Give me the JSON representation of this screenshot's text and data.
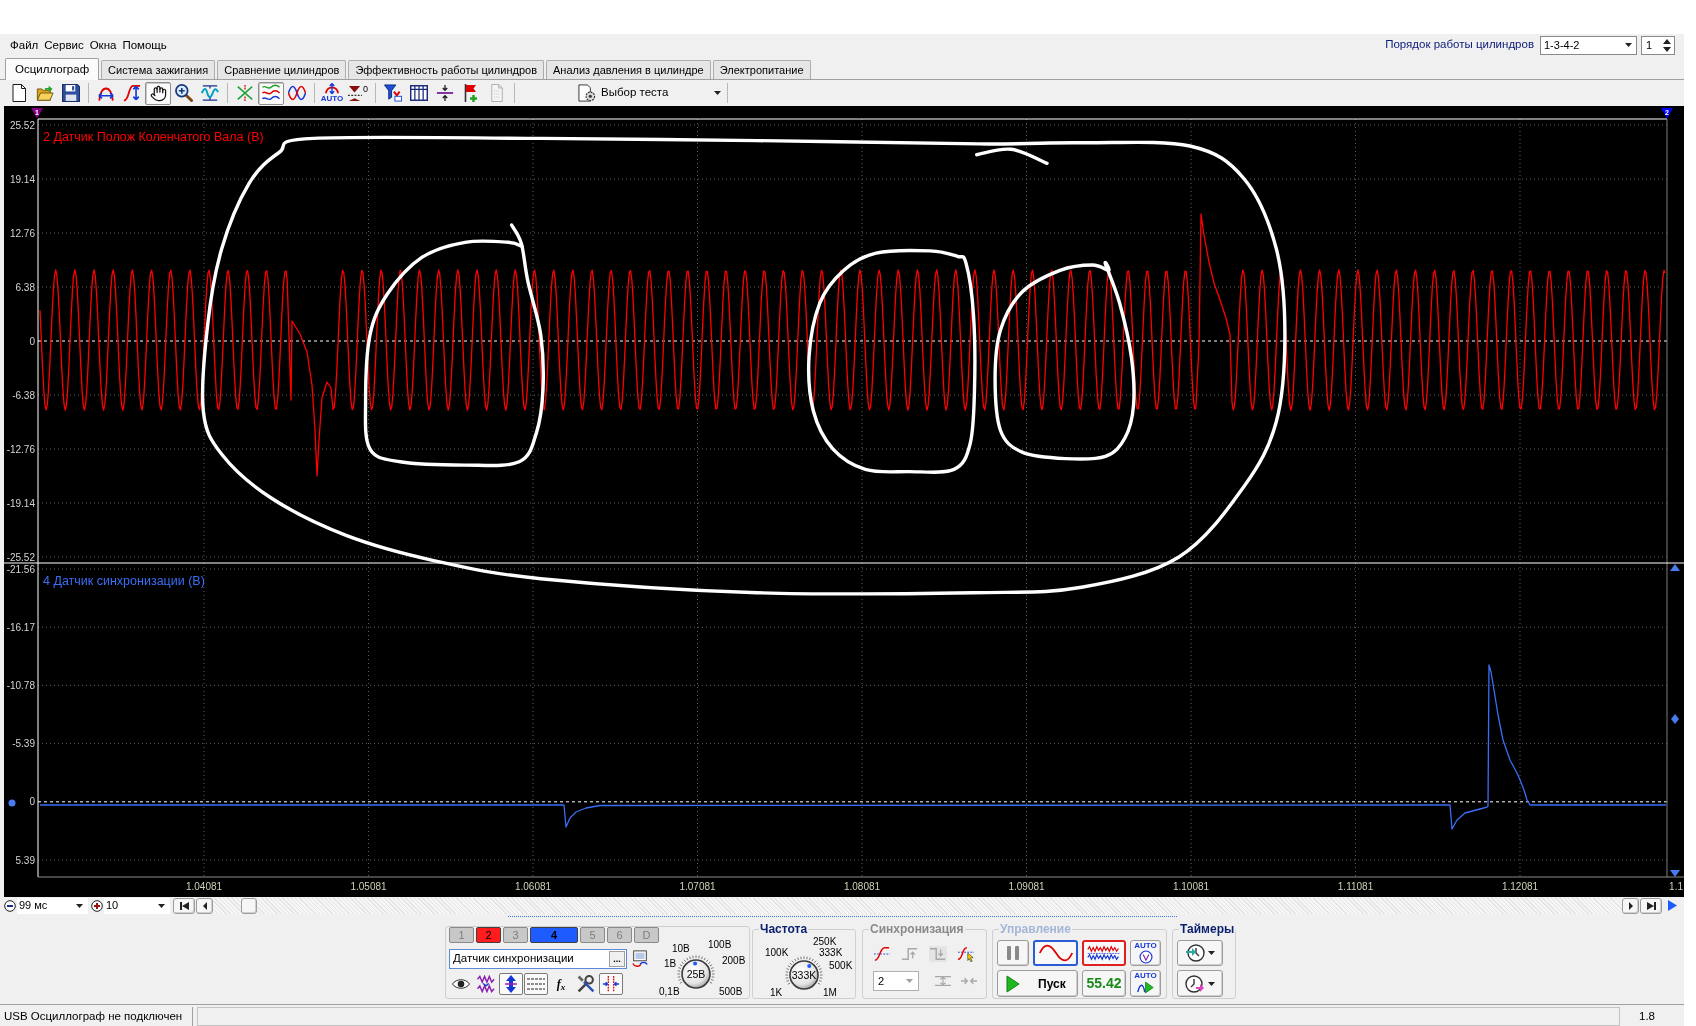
{
  "menu": [
    "Файл",
    "Сервис",
    "Окна",
    "Помощь"
  ],
  "cylinder_order": {
    "label": "Порядок работы цилиндров",
    "value": "1-3-4-2",
    "counter": "1"
  },
  "tabs": [
    {
      "label": "Осциллограф",
      "selected": true
    },
    {
      "label": "Система зажигания",
      "selected": false
    },
    {
      "label": "Сравнение цилиндров",
      "selected": false
    },
    {
      "label": "Эффективность работы цилиндров",
      "selected": false
    },
    {
      "label": "Анализ давления в цилиндре",
      "selected": false
    },
    {
      "label": "Электропитание",
      "selected": false
    }
  ],
  "toolbar": {
    "groups": [
      [
        {
          "kind": "new",
          "pressed": false
        },
        {
          "kind": "open",
          "pressed": false
        },
        {
          "kind": "save",
          "pressed": false
        }
      ],
      [
        {
          "kind": "width",
          "pressed": false
        },
        {
          "kind": "height",
          "pressed": false
        },
        {
          "kind": "hand",
          "pressed": true
        },
        {
          "kind": "zoom",
          "pressed": false
        },
        {
          "kind": "fit",
          "pressed": false
        }
      ],
      [
        {
          "kind": "cross",
          "pressed": false
        },
        {
          "kind": "stack",
          "pressed": true
        },
        {
          "kind": "overlap",
          "pressed": false
        }
      ],
      [
        {
          "kind": "auto",
          "pressed": false,
          "label": "AUTO"
        },
        {
          "kind": "zero",
          "pressed": false,
          "label": "0"
        }
      ],
      [
        {
          "kind": "filter",
          "pressed": false
        },
        {
          "kind": "grid",
          "pressed": false
        },
        {
          "kind": "split",
          "pressed": false
        },
        {
          "kind": "flag",
          "pressed": false
        },
        {
          "kind": "list",
          "pressed": false
        }
      ]
    ],
    "test_select": "Выбор теста"
  },
  "plot": {
    "markers": [
      {
        "label": "1",
        "color": "#800080"
      },
      {
        "label": "2",
        "color": "#0000ff"
      }
    ],
    "channels": [
      {
        "title": "2 Датчик Полож Коленчатого Вала (В)",
        "color": "#ff0000",
        "y_ticks": [
          {
            "label": "25.52",
            "kind": "grid"
          },
          {
            "label": "19.14",
            "kind": "grid"
          },
          {
            "label": "12.76",
            "kind": "grid"
          },
          {
            "label": "6.38",
            "kind": "grid"
          },
          {
            "label": "0",
            "kind": "zero"
          },
          {
            "label": "-6.38",
            "kind": "grid"
          },
          {
            "label": "-12.76",
            "kind": "grid"
          },
          {
            "label": "-19.14",
            "kind": "grid"
          },
          {
            "label": "-25.52",
            "kind": "grid"
          }
        ]
      },
      {
        "title": "4 Датчик синхронизации (В)",
        "color": "#3a6ef5",
        "y_ticks": [
          {
            "label": "-21.56",
            "kind": "grid"
          },
          {
            "label": "-16.17",
            "kind": "grid"
          },
          {
            "label": "-10.78",
            "kind": "grid"
          },
          {
            "label": "-5.39",
            "kind": "grid"
          },
          {
            "label": "0",
            "kind": "zero"
          },
          {
            "label": "5.39",
            "kind": "grid"
          }
        ]
      }
    ],
    "x_labels": [
      "1.04081",
      "1.05081",
      "1.06081",
      "1.07081",
      "1.08081",
      "1.09081",
      "1.10081",
      "1.11081",
      "1.12081",
      "1.1"
    ]
  },
  "time_bar": {
    "time_per_div": "99 мс",
    "zoom": "10"
  },
  "bottom_panel": {
    "channel_buttons": [
      {
        "label": "1",
        "on": false,
        "selected": false,
        "color": "#c8c8c8"
      },
      {
        "label": "2",
        "on": true,
        "selected": false,
        "color": "#ff1c1c"
      },
      {
        "label": "3",
        "on": false,
        "selected": false,
        "color": "#c8c8c8"
      },
      {
        "label": "4",
        "on": true,
        "selected": true,
        "color": "#1f5cff"
      },
      {
        "label": "5",
        "on": false,
        "selected": false,
        "color": "#c8c8c8"
      },
      {
        "label": "6",
        "on": false,
        "selected": false,
        "color": "#c8c8c8"
      },
      {
        "label": "D",
        "on": false,
        "selected": false,
        "color": "#c8c8c8"
      }
    ],
    "channel_name": "Датчик синхронизации",
    "channel_name_button": "...",
    "channel_tools": [
      {
        "kind": "eye",
        "pressed": false
      },
      {
        "kind": "wave",
        "pressed": false
      },
      {
        "kind": "updown",
        "pressed": true
      },
      {
        "kind": "lines",
        "pressed": true
      },
      {
        "kind": "formula",
        "pressed": false,
        "label": "f$_{x}$"
      },
      {
        "kind": "tools",
        "pressed": false
      },
      {
        "kind": "cursor",
        "pressed": true
      }
    ],
    "voltage_dial": {
      "labels": [
        "10В",
        "100В",
        "1В",
        "200В",
        "0,1В",
        "500В"
      ],
      "value": "25В"
    },
    "frequency": {
      "title": "Частота",
      "labels": [
        "250K",
        "100K",
        "333K",
        "500K",
        "1K",
        "1M"
      ],
      "value": "333K"
    },
    "sync": {
      "title": "Синхронизация",
      "disabled": true,
      "channel": "2"
    },
    "control": {
      "title": "Управление",
      "buttons": [
        {
          "kind": "pause"
        },
        {
          "kind": "sine"
        },
        {
          "kind": "noise"
        },
        {
          "kind": "auto-view",
          "label": "AUTO"
        },
        {
          "kind": "start",
          "label": "Пуск"
        },
        {
          "kind": "reading",
          "label": "55.42"
        },
        {
          "kind": "auto-start",
          "label": "AUTO"
        }
      ]
    },
    "timers": {
      "title": "Таймеры"
    }
  },
  "status_bar": {
    "message": "USB Осциллограф не подключен",
    "version": "1.8"
  }
}
